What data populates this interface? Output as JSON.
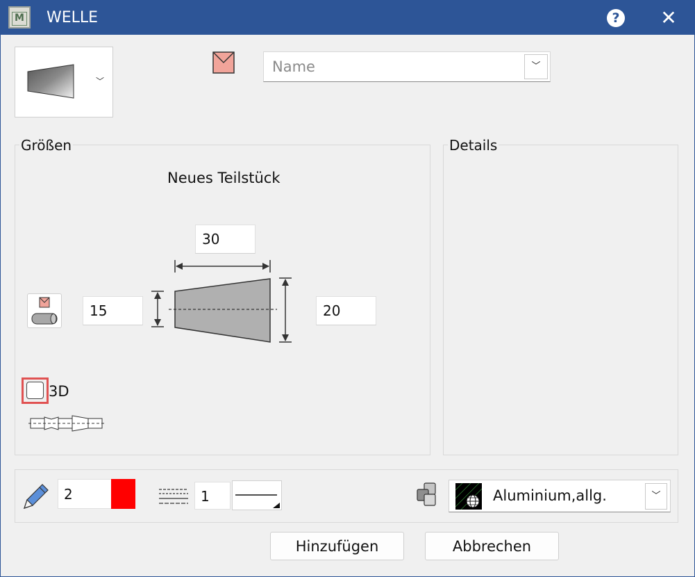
{
  "window": {
    "title": "WELLE",
    "app_icon_letter": "M",
    "help_glyph": "?",
    "close_glyph": "✕"
  },
  "top": {
    "shape_picker": {
      "icon": "tapered-cone-icon",
      "chevron": "﹀"
    },
    "name_icon": "name-flag-icon",
    "name_combo": {
      "placeholder": "Name",
      "value": "",
      "chevron": "﹀"
    }
  },
  "groessen": {
    "label": "Größen",
    "heading": "Neues Teilstück",
    "length_value": "30",
    "left_diameter_value": "15",
    "right_diameter_value": "20",
    "snap_icon": "pick-from-drawing-icon",
    "checkbox": {
      "label": "3D",
      "checked": false
    },
    "shaft_icon": "shaft-segments-icon"
  },
  "details": {
    "label": "Details"
  },
  "bottom": {
    "pen_number": "2",
    "pen_color": "#ff0000",
    "pencil_icon": "pencil-icon",
    "linetype_icon": "linetype-icon",
    "linetype_number": "1",
    "material_icon": "material-blocks-icon",
    "material_name": "Aluminium,allg.",
    "material_chevron": "﹀"
  },
  "buttons": {
    "add": "Hinzufügen",
    "cancel": "Abbrechen"
  },
  "colors": {
    "titlebar": "#2d5597",
    "dialog_bg": "#f0f0f0",
    "highlight": "#e05252"
  }
}
